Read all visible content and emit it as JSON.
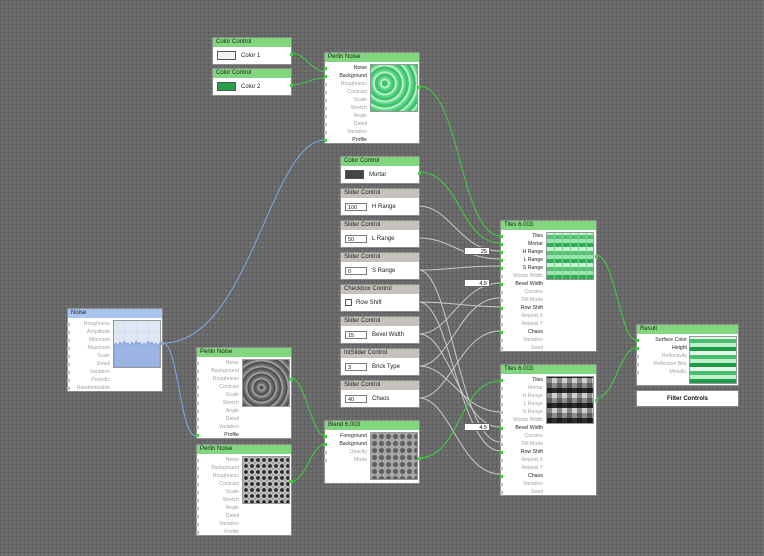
{
  "nodes": {
    "color1": {
      "title": "Color Control",
      "label": "Color 1",
      "swatch": "#eef5ee"
    },
    "color2": {
      "title": "Color Control",
      "label": "Color 2",
      "swatch": "#26a04a"
    },
    "perlin_top": {
      "title": "Perlin Noise",
      "pins": [
        "Noise",
        "Background",
        "Roughness",
        "Contrast",
        "Scale",
        "Stretch",
        "Angle",
        "Detail",
        "Variation",
        "Profile"
      ]
    },
    "mortar": {
      "title": "Color Control",
      "label": "Mortar",
      "swatch": "#454545"
    },
    "slider_h": {
      "title": "Slider Control",
      "value": "100",
      "label": "H Range"
    },
    "slider_l": {
      "title": "Slider Control",
      "value": "50",
      "label": "L Range"
    },
    "slider_s": {
      "title": "Slider Control",
      "value": "0",
      "label": "S Range"
    },
    "checkbox": {
      "title": "Checkbox Control",
      "label": "Row Shift"
    },
    "slider_bevel": {
      "title": "Slider Control",
      "value": "15",
      "label": "Bevel Width"
    },
    "intslider": {
      "title": "IntSlider Control",
      "value": "3",
      "label": "Brick Type"
    },
    "slider_chaos": {
      "title": "Slider Control",
      "value": "40",
      "label": "Chaos"
    },
    "noise": {
      "title": "Noise",
      "pins": [
        "Roughness",
        "Amplitude",
        "Minimum",
        "Maximum",
        "Scale",
        "Detail",
        "Variation",
        "Periodic",
        "Randomizable"
      ]
    },
    "perlin_mid": {
      "title": "Perlin Noise",
      "pins": [
        "Noise",
        "Background",
        "Roughness",
        "Contrast",
        "Scale",
        "Stretch",
        "Angle",
        "Detail",
        "Variation",
        "Profile"
      ]
    },
    "perlin_low": {
      "title": "Perlin Noise",
      "pins": [
        "Noise",
        "Background",
        "Roughness",
        "Contrast",
        "Scale",
        "Stretch",
        "Angle",
        "Detail",
        "Variation",
        "Profile"
      ]
    },
    "blend": {
      "title": "Blend 6.003",
      "pins": [
        "Foreground",
        "Background",
        "Opacity",
        "Mode"
      ]
    },
    "tiles1": {
      "title": "Tiles 6.003",
      "pins": [
        "Tiles",
        "Mortar",
        "H Range",
        "L Range",
        "S Range",
        "Mortar Width",
        "Bevel Width",
        "Corners",
        "Fill Mode",
        "Row Shift",
        "Repeat X",
        "Repeat Y",
        "Chaos",
        "Variation",
        "Seed"
      ],
      "value_a": "25",
      "value_b": "4.5"
    },
    "tiles2": {
      "title": "Tiles 6.003",
      "pins": [
        "Tiles",
        "Mortar",
        "H Range",
        "L Range",
        "S Range",
        "Mortar Width",
        "Bevel Width",
        "Corners",
        "Fill Mode",
        "Row Shift",
        "Repeat X",
        "Repeat Y",
        "Chaos",
        "Variation",
        "Seed"
      ],
      "value_b": "4.5"
    },
    "result": {
      "title": "Result",
      "pins": [
        "Surface Color",
        "Height",
        "Reflectivity",
        "Reflection Blur",
        "Metallic"
      ]
    },
    "filter_controls": {
      "label": "Filter Controls"
    }
  },
  "colors": {
    "header_green": "#82d77e",
    "header_gray": "#c6c1bb",
    "header_blue": "#a9c5ef",
    "wire_green": "#3ecf3e",
    "wire_blue": "#7ea7e8",
    "wire_gray": "#c9c9c9"
  }
}
